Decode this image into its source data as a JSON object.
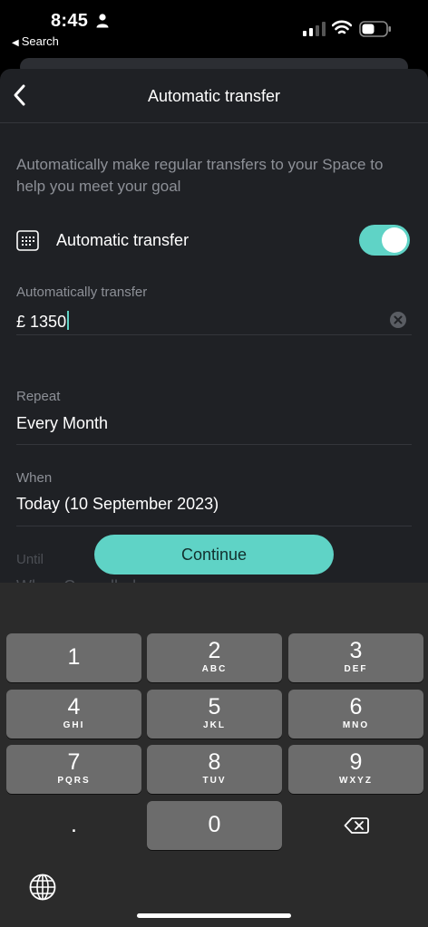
{
  "status_bar": {
    "time": "8:45",
    "back_app": "Search",
    "icons": [
      "person-icon",
      "signal-icon",
      "wifi-icon",
      "battery-icon"
    ]
  },
  "header": {
    "title": "Automatic transfer",
    "back_icon": "chevron-left-icon"
  },
  "intro_text": "Automatically make regular transfers to your Space to help you meet your goal",
  "toggle": {
    "label": "Automatic transfer",
    "icon": "calendar-icon",
    "enabled": true
  },
  "amount": {
    "label": "Automatically transfer",
    "currency": "£",
    "value": "1350"
  },
  "repeat": {
    "label": "Repeat",
    "value": "Every Month"
  },
  "when": {
    "label": "When",
    "value": "Today (10 September 2023)"
  },
  "until": {
    "label": "Until",
    "value": "When Cancelled"
  },
  "continue_label": "Continue",
  "keyboard": {
    "keys": [
      {
        "digit": "1",
        "letters": ""
      },
      {
        "digit": "2",
        "letters": "ABC"
      },
      {
        "digit": "3",
        "letters": "DEF"
      },
      {
        "digit": "4",
        "letters": "GHI"
      },
      {
        "digit": "5",
        "letters": "JKL"
      },
      {
        "digit": "6",
        "letters": "MNO"
      },
      {
        "digit": "7",
        "letters": "PQRS"
      },
      {
        "digit": "8",
        "letters": "TUV"
      },
      {
        "digit": "9",
        "letters": "WXYZ"
      }
    ],
    "decimal": ".",
    "zero": "0"
  },
  "colors": {
    "accent": "#5fd3c6",
    "sheet_background": "#1f2125",
    "secondary_text": "#8d9097",
    "key_background": "#6c6c6c"
  }
}
